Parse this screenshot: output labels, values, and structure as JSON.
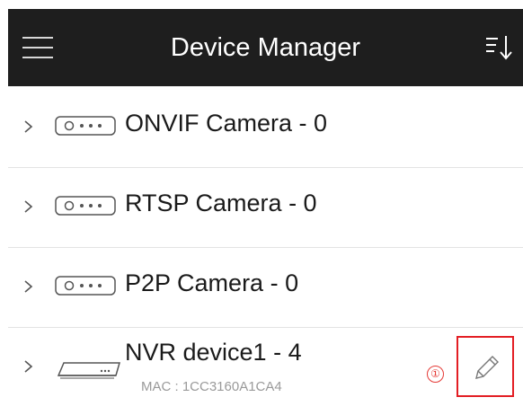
{
  "header": {
    "title": "Device Manager",
    "menu_icon": "hamburger-menu-icon",
    "sort_icon": "sort-descending-icon"
  },
  "devices": [
    {
      "label": "ONVIF Camera - 0",
      "icon": "camera-device-icon"
    },
    {
      "label": "RTSP Camera - 0",
      "icon": "camera-device-icon"
    },
    {
      "label": "P2P Camera - 0",
      "icon": "camera-device-icon"
    },
    {
      "label": "NVR device1 - 4",
      "icon": "nvr-device-icon",
      "mac": "MAC : 1CC3160A1CA4",
      "marker": "①"
    }
  ],
  "colors": {
    "header_bg": "#1e1e1e",
    "header_text": "#ffffff",
    "highlight": "#e31e24",
    "mac_text": "#9a9a9a"
  }
}
